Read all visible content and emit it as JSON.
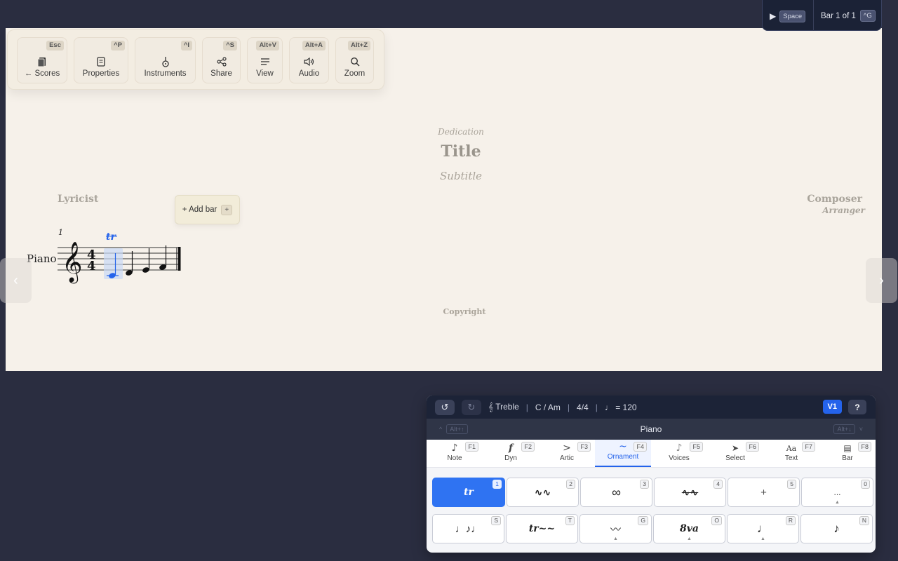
{
  "toolbar": {
    "buttons": [
      {
        "label": "← Scores",
        "key": "Esc",
        "icon": "book-icon"
      },
      {
        "label": "Properties",
        "key": "^P",
        "icon": "document-icon"
      },
      {
        "label": "Instruments",
        "key": "^I",
        "icon": "guitar-icon"
      },
      {
        "label": "Share",
        "key": "^S",
        "icon": "share-icon"
      },
      {
        "label": "View",
        "key": "Alt+V",
        "icon": "lines-icon"
      },
      {
        "label": "Audio",
        "key": "Alt+A",
        "icon": "speaker-icon"
      },
      {
        "label": "Zoom",
        "key": "Alt+Z",
        "icon": "magnifier-icon"
      }
    ]
  },
  "playback": {
    "play_key": "Space",
    "bar_text": "Bar 1 of 1",
    "bar_key": "^G"
  },
  "score": {
    "dedication": "Dedication",
    "title": "Title",
    "subtitle": "Subtitle",
    "lyricist": "Lyricist",
    "composer": "Composer",
    "arranger": "Arranger",
    "copyright": "Copyright",
    "instrument": "Piano",
    "measure_number": "1",
    "ornament_mark": "tr",
    "time_sig_top": "4",
    "time_sig_bottom": "4",
    "add_bar_label": "+ Add bar",
    "add_bar_key": "+"
  },
  "palette": {
    "clef": "𝄞 Treble",
    "key": "C / Am",
    "time": "4/4",
    "tempo": "♩ = 120",
    "voice": "V1",
    "help": "?",
    "staff_name": "Piano",
    "staff_prev_key": "Alt+↑",
    "staff_next_key": "Alt+↓",
    "tabs": [
      {
        "label": "Note",
        "key": "F1",
        "icon": "♪"
      },
      {
        "label": "Dyn",
        "key": "F2",
        "icon": "f"
      },
      {
        "label": "Artic",
        "key": "F3",
        "icon": ">"
      },
      {
        "label": "Ornament",
        "key": "F4",
        "icon": "~"
      },
      {
        "label": "Voices",
        "key": "F5",
        "icon": "♪"
      },
      {
        "label": "Select",
        "key": "F6",
        "icon": "➤"
      },
      {
        "label": "Text",
        "key": "F7",
        "icon": "Aa"
      },
      {
        "label": "Bar",
        "key": "F8",
        "icon": "▤"
      }
    ],
    "row1": [
      {
        "glyph": "tr",
        "key": "1"
      },
      {
        "glyph": "∿∿",
        "key": "2"
      },
      {
        "glyph": "∞",
        "key": "3"
      },
      {
        "glyph": "∿∿",
        "key": "4"
      },
      {
        "glyph": "+",
        "key": "5"
      },
      {
        "glyph": "...",
        "key": "0"
      }
    ],
    "row2": [
      {
        "glyph": "♩♪♩",
        "key": "S"
      },
      {
        "glyph": "tr~~",
        "key": "T"
      },
      {
        "glyph": "〰",
        "key": "G"
      },
      {
        "glyph": "8va",
        "key": "O"
      },
      {
        "glyph": "♩",
        "key": "R"
      },
      {
        "glyph": "♪",
        "key": "N"
      }
    ]
  }
}
